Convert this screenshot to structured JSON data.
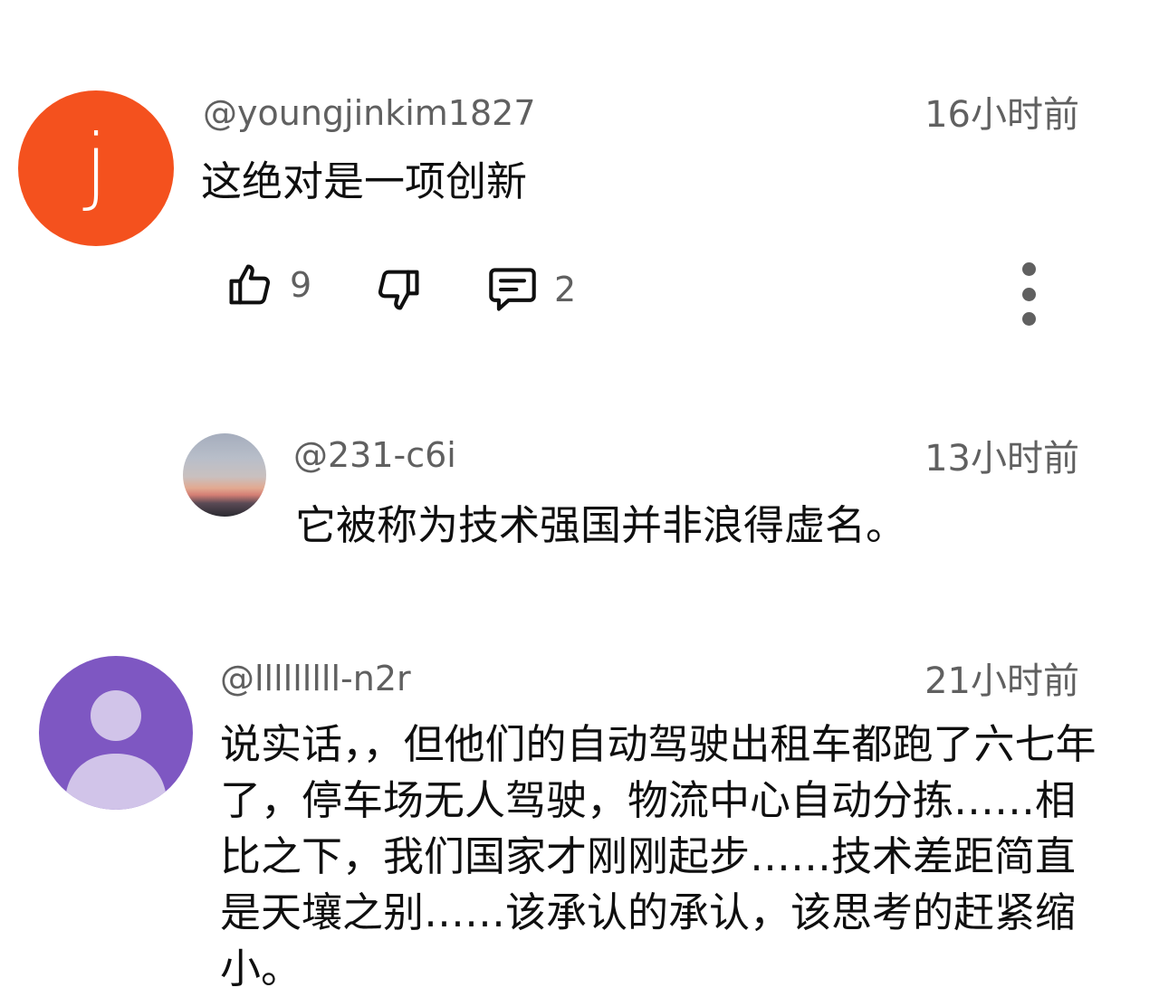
{
  "comments": [
    {
      "avatar_letter": "j",
      "avatar_color": "#f4511e",
      "handle": "@youngjinkim1827",
      "time": "16小时前",
      "text": "这绝对是一项创新",
      "likes": "9",
      "replies": "2"
    },
    {
      "avatar_type": "photo-sunset-sky",
      "handle": "@231-c6i",
      "time": "13小时前",
      "text": "它被称为技术强国并非浪得虚名。"
    },
    {
      "avatar_type": "default-person",
      "avatar_color": "#7e57c2",
      "handle": "@lllllllll-n2r",
      "time": "21小时前",
      "text": "说实话，，但他们的自动驾驶出租车都跑了六七年了，停车场无人驾驶，物流中心自动分拣……相比之下，我们国家才刚刚起步……技术差距简直是天壤之别……该承认的承认，该思考的赶紧缩小。"
    }
  ],
  "icons": {
    "like": "thumbs-up-icon",
    "dislike": "thumbs-down-icon",
    "reply": "comment-icon",
    "more": "more-vertical-icon"
  },
  "colors": {
    "secondary_text": "#606060",
    "primary_text": "#0f0f0f"
  }
}
